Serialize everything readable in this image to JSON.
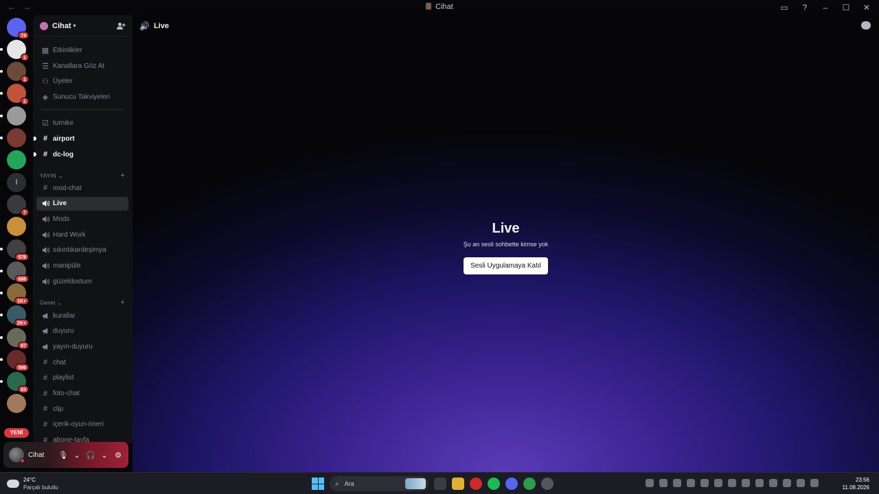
{
  "window": {
    "title": "Cihat",
    "nav_back": "←",
    "nav_forward": "→"
  },
  "servers": [
    {
      "badge": "74",
      "color": "#5865f2"
    },
    {
      "badge": "1",
      "color": "#e6e6e6"
    },
    {
      "badge": "1",
      "color": "#6b4a3a"
    },
    {
      "badge": "1",
      "color": "#c0543a"
    },
    {
      "badge": "",
      "color": "#9a9a9a"
    },
    {
      "badge": "",
      "color": "#7a3a30"
    },
    {
      "badge": "",
      "color": "#23a55a"
    },
    {
      "badge": "",
      "color": "#2b2d31",
      "letter": "l"
    },
    {
      "badge": "7",
      "color": "#3a3a3a"
    },
    {
      "badge": "",
      "color": "#c8923a"
    },
    {
      "badge": "578",
      "color": "#404040"
    },
    {
      "badge": "686",
      "color": "#5a5a5a"
    },
    {
      "badge": "1K+",
      "color": "#8a6a3a"
    },
    {
      "badge": "2K+",
      "color": "#3a5a6a"
    },
    {
      "badge": "87",
      "color": "#6a6a5a"
    },
    {
      "badge": "596",
      "color": "#6a2a2a"
    },
    {
      "badge": "83",
      "color": "#2a6a4a"
    },
    {
      "badge": "",
      "color": "#a07a5a"
    }
  ],
  "new_pill": "YENİ",
  "server_header": {
    "name": "Cihat",
    "chevron": "▾",
    "invite_icon": "person-add"
  },
  "top_links": [
    {
      "label": "Etkinlikler",
      "icon": "▦"
    },
    {
      "label": "Kanallara Göz At",
      "icon": "☰"
    },
    {
      "label": "Üyeler",
      "icon": "⚇"
    },
    {
      "label": "Sunucu Takviyeleri",
      "icon": "◈"
    }
  ],
  "channels_top": [
    {
      "label": "turnike",
      "icon": "☑",
      "state": "normal"
    },
    {
      "label": "airport",
      "icon": "#",
      "state": "unread"
    },
    {
      "label": "dc-log",
      "icon": "#",
      "state": "unread"
    }
  ],
  "category_yayin": {
    "label": "YAYIN",
    "chevron": "⌄",
    "plus": "+",
    "channels": [
      {
        "label": "mod-chat",
        "icon": "#",
        "state": "normal"
      },
      {
        "label": "Live",
        "icon": "🔊",
        "state": "active"
      },
      {
        "label": "Mods",
        "icon": "🔊",
        "state": "normal"
      },
      {
        "label": "Hard Work",
        "icon": "🔊",
        "state": "normal"
      },
      {
        "label": "sıkıntıkardeşimya",
        "icon": "🔊",
        "state": "normal"
      },
      {
        "label": "manipüle",
        "icon": "🔊",
        "state": "normal"
      },
      {
        "label": "güzeldostum",
        "icon": "🔊",
        "state": "normal"
      }
    ]
  },
  "category_genel": {
    "label": "Genel",
    "chevron": "⌄",
    "plus": "+",
    "channels": [
      {
        "label": "kurallar",
        "icon": "📢",
        "state": "normal"
      },
      {
        "label": "duyuru",
        "icon": "📢",
        "state": "normal"
      },
      {
        "label": "yayın-duyuru",
        "icon": "📢",
        "state": "normal"
      },
      {
        "label": "chat",
        "icon": "#",
        "state": "normal"
      },
      {
        "label": "playlist",
        "icon": "#",
        "state": "normal"
      },
      {
        "label": "foto-chat",
        "icon": "#",
        "state": "normal"
      },
      {
        "label": "clip",
        "icon": "#",
        "state": "normal"
      },
      {
        "label": "içerik-oyun-öneri",
        "icon": "#",
        "state": "normal"
      },
      {
        "label": "abone-tayfa",
        "icon": "#",
        "state": "normal"
      }
    ]
  },
  "user_panel": {
    "name": "Cihat",
    "mic_icon": "🎙",
    "headset_icon": "🎧",
    "settings_icon": "⚙",
    "chevron": "⌄"
  },
  "channel_header": {
    "icon": "🔊",
    "title": "Live"
  },
  "voice_stage": {
    "title": "Live",
    "subtitle": "Şu an sesli sohbette kimse yok",
    "join_label": "Sesli Uygulamaya Katıl"
  },
  "taskbar": {
    "weather_temp": "24°C",
    "weather_desc": "Parçalı bulutlu",
    "search_placeholder": "Ara",
    "time": "23:56",
    "date": "11.08.2026",
    "apps": [
      "#3b3b44",
      "#e0b030",
      "#d02828",
      "#1db954",
      "#5865f2",
      "#2a9d4a",
      "#555560"
    ]
  }
}
